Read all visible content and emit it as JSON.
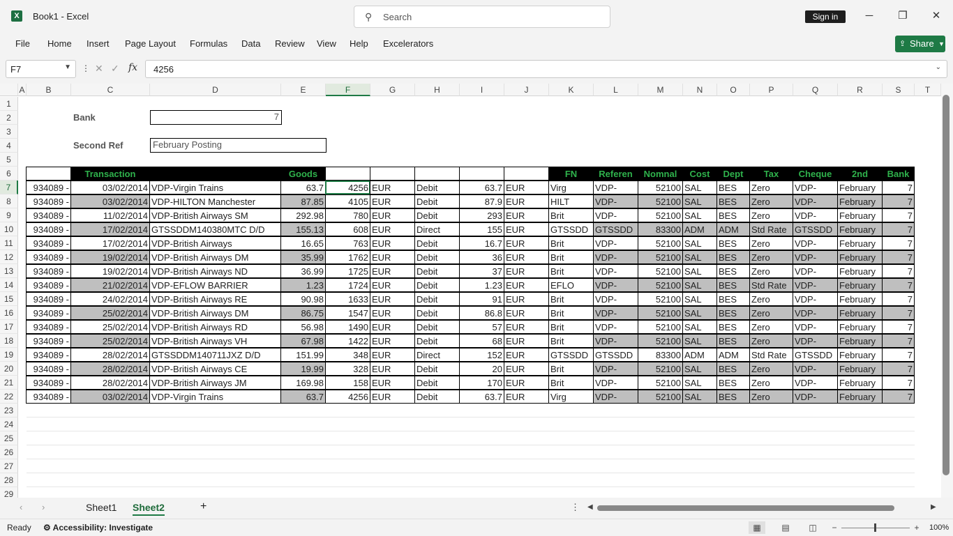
{
  "app": {
    "title": "Book1  -  Excel",
    "icon_letter": "X",
    "search_placeholder": "Search",
    "signin": "Sign in",
    "share": "Share",
    "brand_color": "#1e7a45"
  },
  "menu": [
    "File",
    "Home",
    "Insert",
    "Page Layout",
    "Formulas",
    "Data",
    "Review",
    "View",
    "Help",
    "Excelerators"
  ],
  "formula_bar": {
    "name_box": "F7",
    "formula": "4256",
    "fx": "fx"
  },
  "columns": [
    "A",
    "B",
    "C",
    "D",
    "E",
    "F",
    "G",
    "H",
    "I",
    "J",
    "K",
    "L",
    "M",
    "N",
    "O",
    "P",
    "Q",
    "R",
    "S",
    "T"
  ],
  "rows": [
    "1",
    "2",
    "3",
    "4",
    "5",
    "6",
    "7",
    "8",
    "9",
    "10",
    "11",
    "12",
    "13",
    "14",
    "15",
    "16",
    "17",
    "18",
    "19",
    "20",
    "21",
    "22",
    "23",
    "24",
    "25",
    "26",
    "27",
    "28",
    "29"
  ],
  "form": {
    "bank_label": "Bank",
    "bank_value": "7",
    "second_ref_label": "Second Ref",
    "second_ref_value": "February Posting"
  },
  "table": {
    "headers": [
      "",
      "Transaction",
      "",
      "Goods",
      "",
      "",
      "",
      "",
      "",
      "FN",
      "Referen",
      "Nomnal",
      "Cost",
      "Dept",
      "Tax",
      "Cheque",
      "2nd",
      "Bank"
    ],
    "header_colors": {
      "background": "#000000",
      "text": "#2fb24c"
    },
    "rows": [
      [
        "934089 -",
        "03/02/2014",
        "VDP-Virgin Trains",
        "63.7",
        "4256",
        "EUR",
        "Debit",
        "63.7",
        "EUR",
        "Virg",
        "VDP-",
        "52100",
        "SAL",
        "BES",
        "Zero",
        "VDP-",
        "February",
        "7"
      ],
      [
        "934089 -",
        "03/02/2014",
        "VDP-HILTON Manchester",
        "87.85",
        "4105",
        "EUR",
        "Debit",
        "87.9",
        "EUR",
        "HILT",
        "VDP-",
        "52100",
        "SAL",
        "BES",
        "Zero",
        "VDP-",
        "February",
        "7"
      ],
      [
        "934089 -",
        "11/02/2014",
        "VDP-British Airways SM",
        "292.98",
        "780",
        "EUR",
        "Debit",
        "293",
        "EUR",
        "Brit",
        "VDP-",
        "52100",
        "SAL",
        "BES",
        "Zero",
        "VDP-",
        "February",
        "7"
      ],
      [
        "934089 -",
        "17/02/2014",
        "GTSSDDM140380MTC D/D",
        "155.13",
        "608",
        "EUR",
        "Direct",
        "155",
        "EUR",
        "GTSSDD",
        "GTSSDD",
        "83300",
        "ADM",
        "ADM",
        "Std Rate",
        "GTSSDD",
        "February",
        "7"
      ],
      [
        "934089 -",
        "17/02/2014",
        "VDP-British Airways",
        "16.65",
        "763",
        "EUR",
        "Debit",
        "16.7",
        "EUR",
        "Brit",
        "VDP-",
        "52100",
        "SAL",
        "BES",
        "Zero",
        "VDP-",
        "February",
        "7"
      ],
      [
        "934089 -",
        "19/02/2014",
        "VDP-British Airways DM",
        "35.99",
        "1762",
        "EUR",
        "Debit",
        "36",
        "EUR",
        "Brit",
        "VDP-",
        "52100",
        "SAL",
        "BES",
        "Zero",
        "VDP-",
        "February",
        "7"
      ],
      [
        "934089 -",
        "19/02/2014",
        "VDP-British Airways ND",
        "36.99",
        "1725",
        "EUR",
        "Debit",
        "37",
        "EUR",
        "Brit",
        "VDP-",
        "52100",
        "SAL",
        "BES",
        "Zero",
        "VDP-",
        "February",
        "7"
      ],
      [
        "934089 -",
        "21/02/2014",
        "VDP-EFLOW BARRIER",
        "1.23",
        "1724",
        "EUR",
        "Debit",
        "1.23",
        "EUR",
        "EFLO",
        "VDP-",
        "52100",
        "SAL",
        "BES",
        "Std Rate",
        "VDP-",
        "February",
        "7"
      ],
      [
        "934089 -",
        "24/02/2014",
        "VDP-British Airways RE",
        "90.98",
        "1633",
        "EUR",
        "Debit",
        "91",
        "EUR",
        "Brit",
        "VDP-",
        "52100",
        "SAL",
        "BES",
        "Zero",
        "VDP-",
        "February",
        "7"
      ],
      [
        "934089 -",
        "25/02/2014",
        "VDP-British Airways DM",
        "86.75",
        "1547",
        "EUR",
        "Debit",
        "86.8",
        "EUR",
        "Brit",
        "VDP-",
        "52100",
        "SAL",
        "BES",
        "Zero",
        "VDP-",
        "February",
        "7"
      ],
      [
        "934089 -",
        "25/02/2014",
        "VDP-British Airways RD",
        "56.98",
        "1490",
        "EUR",
        "Debit",
        "57",
        "EUR",
        "Brit",
        "VDP-",
        "52100",
        "SAL",
        "BES",
        "Zero",
        "VDP-",
        "February",
        "7"
      ],
      [
        "934089 -",
        "25/02/2014",
        "VDP-British Airways VH",
        "67.98",
        "1422",
        "EUR",
        "Debit",
        "68",
        "EUR",
        "Brit",
        "VDP-",
        "52100",
        "SAL",
        "BES",
        "Zero",
        "VDP-",
        "February",
        "7"
      ],
      [
        "934089 -",
        "28/02/2014",
        "GTSSDDM140711JXZ D/D",
        "151.99",
        "348",
        "EUR",
        "Direct",
        "152",
        "EUR",
        "GTSSDD",
        "GTSSDD",
        "83300",
        "ADM",
        "ADM",
        "Std Rate",
        "GTSSDD",
        "February",
        "7"
      ],
      [
        "934089 -",
        "28/02/2014",
        "VDP-British Airways CE",
        "19.99",
        "328",
        "EUR",
        "Debit",
        "20",
        "EUR",
        "Brit",
        "VDP-",
        "52100",
        "SAL",
        "BES",
        "Zero",
        "VDP-",
        "February",
        "7"
      ],
      [
        "934089 -",
        "28/02/2014",
        "VDP-British Airways JM",
        "169.98",
        "158",
        "EUR",
        "Debit",
        "170",
        "EUR",
        "Brit",
        "VDP-",
        "52100",
        "SAL",
        "BES",
        "Zero",
        "VDP-",
        "February",
        "7"
      ],
      [
        "934089 -",
        "03/02/2014",
        "VDP-Virgin Trains",
        "63.7",
        "4256",
        "EUR",
        "Debit",
        "63.7",
        "EUR",
        "Virg",
        "VDP-",
        "52100",
        "SAL",
        "BES",
        "Zero",
        "VDP-",
        "February",
        "7"
      ]
    ]
  },
  "sheets": [
    "Sheet1",
    "Sheet2"
  ],
  "active_sheet": "Sheet2",
  "status": {
    "ready": "Ready",
    "accessibility": "Accessibility: Investigate",
    "zoom": "100%"
  }
}
